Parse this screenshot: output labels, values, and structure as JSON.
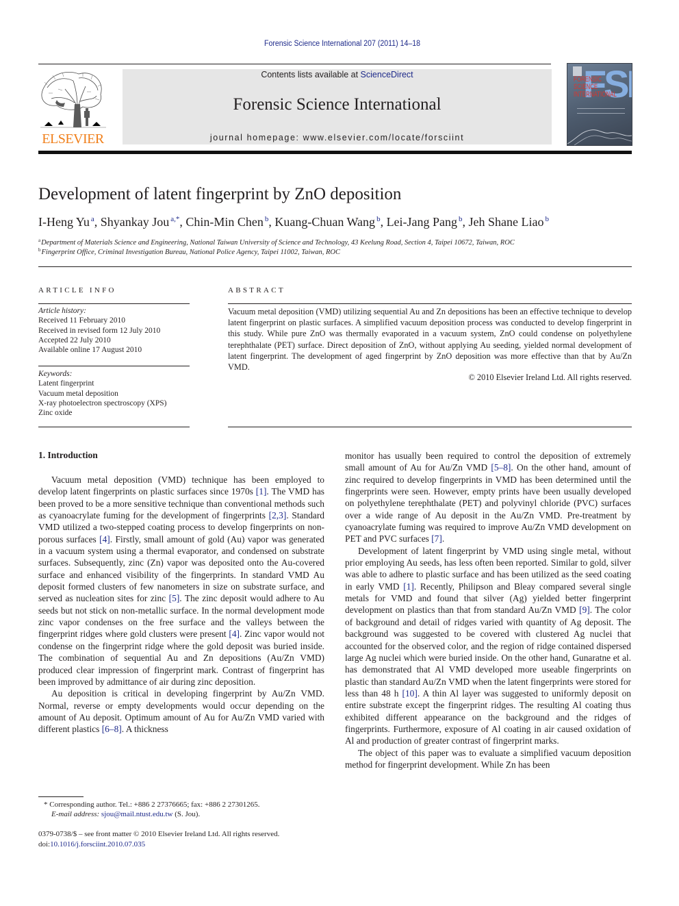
{
  "header": {
    "citation": "Forensic Science International 207 (2011) 14–18",
    "contents_prefix": "Contents lists available at ",
    "contents_link": "ScienceDirect",
    "journal_title": "Forensic Science International",
    "homepage": "journal homepage: www.elsevier.com/locate/forsciint",
    "publisher_logo_text": "ELSEVIER",
    "cover": {
      "big_letters": "FSI",
      "title_lines": [
        "FORENSIC",
        "SCIENCE",
        "INTERNATIONAL"
      ]
    }
  },
  "colors": {
    "link": "#1e2a8a",
    "elsevier_orange": "#f07f1a",
    "masthead_bg": "#e6e6e6",
    "text": "#231f20"
  },
  "article": {
    "title": "Development of latent fingerprint by ZnO deposition",
    "authors": [
      {
        "name": "I-Heng Yu",
        "sup": "a",
        "sep": ", "
      },
      {
        "name": "Shyankay Jou",
        "sup": "a,*",
        "sep": ", "
      },
      {
        "name": "Chin-Min Chen",
        "sup": "b",
        "sep": ", "
      },
      {
        "name": "Kuang-Chuan Wang",
        "sup": "b",
        "sep": ", "
      },
      {
        "name": "Lei-Jang Pang",
        "sup": "b",
        "sep": ", "
      },
      {
        "name": "Jeh Shane Liao",
        "sup": "b",
        "sep": ""
      }
    ],
    "affiliations": [
      {
        "mark": "a",
        "text": "Department of Materials Science and Engineering, National Taiwan University of Science and Technology, 43 Keelung Road, Section 4, Taipei 10672, Taiwan, ROC"
      },
      {
        "mark": "b",
        "text": "Fingerprint Office, Criminal Investigation Bureau, National Police Agency, Taipei 11002, Taiwan, ROC"
      }
    ]
  },
  "article_info": {
    "label": "ARTICLE INFO",
    "history_heading": "Article history:",
    "history": [
      "Received 11 February 2010",
      "Received in revised form 12 July 2010",
      "Accepted 22 July 2010",
      "Available online 17 August 2010"
    ],
    "keywords_heading": "Keywords:",
    "keywords": [
      "Latent fingerprint",
      "Vacuum metal deposition",
      "X-ray photoelectron spectroscopy (XPS)",
      "Zinc oxide"
    ]
  },
  "abstract": {
    "label": "ABSTRACT",
    "text": "Vacuum metal deposition (VMD) utilizing sequential Au and Zn depositions has been an effective technique to develop latent fingerprint on plastic surfaces. A simplified vacuum deposition process was conducted to develop fingerprint in this study. While pure ZnO was thermally evaporated in a vacuum system, ZnO could condense on polyethylene terephthalate (PET) surface. Direct deposition of ZnO, without applying Au seeding, yielded normal development of latent fingerprint. The development of aged fingerprint by ZnO deposition was more effective than that by Au/Zn VMD.",
    "copyright": "© 2010 Elsevier Ireland Ltd. All rights reserved."
  },
  "body": {
    "section_heading": "1.  Introduction",
    "left_paragraphs": [
      [
        {
          "t": "Vacuum metal deposition (VMD) technique has been employed to develop latent fingerprints on plastic surfaces since 1970s "
        },
        {
          "ref": "[1]"
        },
        {
          "t": ". The VMD has been proved to be a more sensitive technique than conventional methods such as cyanoacrylate fuming for the development of fingerprints "
        },
        {
          "ref": "[2,3]"
        },
        {
          "t": ". Standard VMD utilized a two-stepped coating process to develop fingerprints on non-porous surfaces "
        },
        {
          "ref": "[4]"
        },
        {
          "t": ". Firstly, small amount of gold (Au) vapor was generated in a vacuum system using a thermal evaporator, and condensed on substrate surfaces. Subsequently, zinc (Zn) vapor was deposited onto the Au-covered surface and enhanced visibility of the fingerprints. In standard VMD Au deposit formed clusters of few nanometers in size on substrate surface, and served as nucleation sites for zinc "
        },
        {
          "ref": "[5]"
        },
        {
          "t": ". The zinc deposit would adhere to Au seeds but not stick on non-metallic surface. In the normal development mode zinc vapor condenses on the free surface and the valleys between the fingerprint ridges where gold clusters were present "
        },
        {
          "ref": "[4]"
        },
        {
          "t": ". Zinc vapor would not condense on the fingerprint ridge where the gold deposit was buried inside. The combination of sequential Au and Zn depositions (Au/Zn VMD) produced clear impression of fingerprint mark. Contrast of fingerprint has been improved by admittance of air during zinc deposition."
        }
      ],
      [
        {
          "t": "Au deposition is critical in developing fingerprint by Au/Zn VMD. Normal, reverse or empty developments would occur depending on the amount of Au deposit. Optimum amount of Au for Au/Zn VMD varied with different plastics "
        },
        {
          "ref": "[6–8]"
        },
        {
          "t": ". A thickness"
        }
      ]
    ],
    "right_paragraphs": [
      [
        {
          "t": "monitor has usually been required to control the deposition of extremely small amount of Au for Au/Zn VMD "
        },
        {
          "ref": "[5–8]"
        },
        {
          "t": ". On the other hand, amount of zinc required to develop fingerprints in VMD has been determined until the fingerprints were seen. However, empty prints have been usually developed on polyethylene terephthalate (PET) and polyvinyl chloride (PVC) surfaces over a wide range of Au deposit in the Au/Zn VMD. Pre-treatment by cyanoacrylate fuming was required to improve Au/Zn VMD development on PET and PVC surfaces "
        },
        {
          "ref": "[7]"
        },
        {
          "t": "."
        }
      ],
      [
        {
          "t": "Development of latent fingerprint by VMD using single metal, without prior employing Au seeds, has less often been reported. Similar to gold, silver was able to adhere to plastic surface and has been utilized as the seed coating in early VMD "
        },
        {
          "ref": "[1]"
        },
        {
          "t": ". Recently, Philipson and Bleay compared several single metals for VMD and found that silver (Ag) yielded better fingerprint development on plastics than that from standard Au/Zn VMD "
        },
        {
          "ref": "[9]"
        },
        {
          "t": ". The color of background and detail of ridges varied with quantity of Ag deposit. The background was suggested to be covered with clustered Ag nuclei that accounted for the observed color, and the region of ridge contained dispersed large Ag nuclei which were buried inside. On the other hand, Gunaratne et al. has demonstrated that Al VMD developed more useable fingerprints on plastic than standard Au/Zn VMD when the latent fingerprints were stored for less than 48 h "
        },
        {
          "ref": "[10]"
        },
        {
          "t": ". A thin Al layer was suggested to uniformly deposit on entire substrate except the fingerprint ridges. The resulting Al coating thus exhibited different appearance on the background and the ridges of fingerprints. Furthermore, exposure of Al coating in air caused oxidation of Al and production of greater contrast of fingerprint marks."
        }
      ],
      [
        {
          "t": "The object of this paper was to evaluate a simplified vacuum deposition method for fingerprint development. While Zn has been"
        }
      ]
    ]
  },
  "footnotes": {
    "corresponding": "* Corresponding author. Tel.: +886 2 27376665; fax: +886 2 27301265.",
    "email_label": "E-mail address: ",
    "email": "sjou@mail.ntust.edu.tw",
    "email_suffix": " (S. Jou).",
    "front_matter": "0379-0738/$ – see front matter © 2010 Elsevier Ireland Ltd. All rights reserved.",
    "doi_prefix": "doi:",
    "doi": "10.1016/j.forsciint.2010.07.035"
  }
}
